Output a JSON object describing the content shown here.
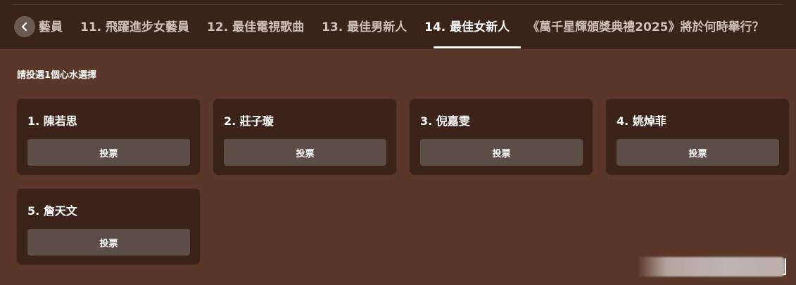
{
  "tabs": [
    {
      "label": "藝員"
    },
    {
      "label": "11. 飛躍進步女藝員"
    },
    {
      "label": "12. 最佳電視歌曲"
    },
    {
      "label": "13. 最佳男新人"
    },
    {
      "label": "14. 最佳女新人"
    },
    {
      "label": "《萬千星輝頒獎典禮2025》將於何時舉行？"
    }
  ],
  "active_tab": "14. 最佳女新人",
  "instruction": "請投選1個心水選擇",
  "candidates": [
    {
      "name": "1. 陳若思",
      "button": "投票"
    },
    {
      "name": "2. 莊子璇",
      "button": "投票"
    },
    {
      "name": "3. 倪嘉雯",
      "button": "投票"
    },
    {
      "name": "4. 姚焯菲",
      "button": "投票"
    },
    {
      "name": "5. 詹天文",
      "button": "投票"
    }
  ],
  "icons": {
    "back": "chevron-left-icon"
  },
  "colors": {
    "background": "#5a3728",
    "header": "#3a2419",
    "card": "#3c231a",
    "button": "#5c4d47",
    "text": "#ffffff",
    "inactive_tab": "#cdbfb8"
  }
}
